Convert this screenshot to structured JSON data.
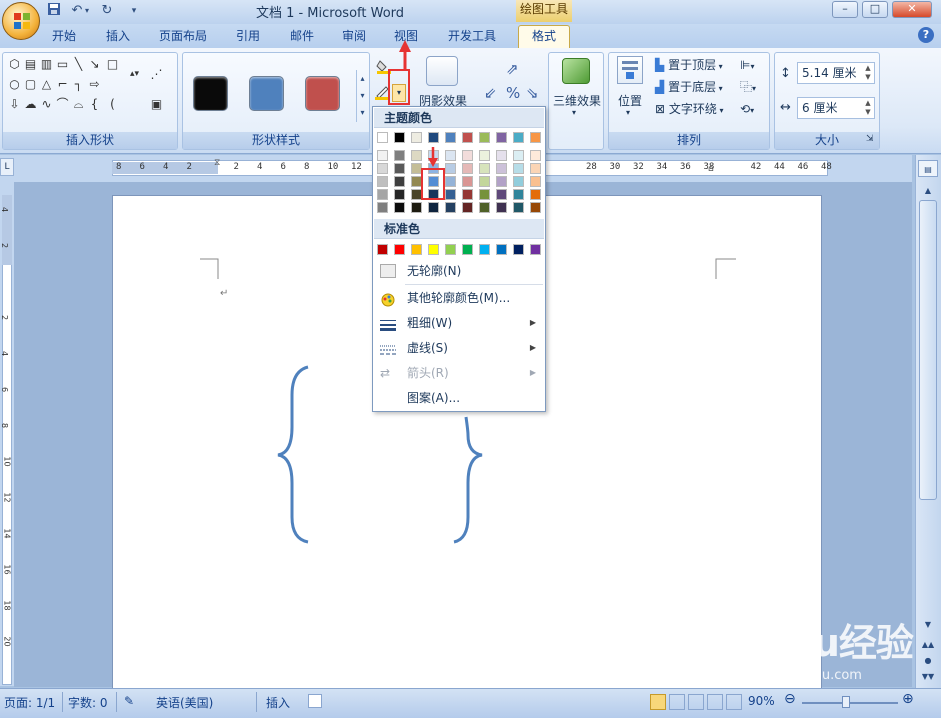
{
  "app": {
    "title": "文档 1 - Microsoft Word",
    "context_tab": "绘图工具",
    "window_buttons": [
      "–",
      "□",
      "✕"
    ]
  },
  "quick_access": {
    "items": [
      "save-icon",
      "undo-icon",
      "redo-icon",
      "customize-icon"
    ]
  },
  "tabs": [
    {
      "label": "开始"
    },
    {
      "label": "插入"
    },
    {
      "label": "页面布局"
    },
    {
      "label": "引用"
    },
    {
      "label": "邮件"
    },
    {
      "label": "审阅"
    },
    {
      "label": "视图"
    },
    {
      "label": "开发工具"
    },
    {
      "label": "格式"
    }
  ],
  "ribbon": {
    "insert_shapes_label": "插入形状",
    "shape_styles_label": "形状样式",
    "shadow_effect_label": "阴影效果",
    "three_d_label": "三维效果",
    "arrange_label": "排列",
    "size_label": "大小",
    "position_label": "位置",
    "bring_front": "置于顶层",
    "send_back": "置于底层",
    "text_wrap": "文字环绕",
    "height_value": "5.14 厘米",
    "width_value": "6 厘米",
    "style_colors": [
      "#0a0a0a",
      "#4f81bd",
      "#c0504d"
    ]
  },
  "ruler": {
    "ticks": [
      "8",
      "6",
      "4",
      "2",
      "",
      "2",
      "4",
      "6",
      "8",
      "10",
      "12",
      "",
      "",
      "",
      "",
      "",
      "",
      "",
      "",
      "",
      "28",
      "30",
      "32",
      "34",
      "36",
      "38",
      "",
      "42",
      "44",
      "46",
      "48"
    ]
  },
  "menu": {
    "theme_colors_label": "主题颜色",
    "standard_colors_label": "标准色",
    "theme_top": [
      "#ffffff",
      "#000000",
      "#eeece1",
      "#1f497d",
      "#4f81bd",
      "#c0504d",
      "#9bbb59",
      "#8064a2",
      "#4bacc6",
      "#f79646"
    ],
    "theme_grid": [
      [
        "#f2f2f2",
        "#7f7f7f",
        "#ddd9c3",
        "#c6d9f0",
        "#dbe5f1",
        "#f2dcdb",
        "#ebf1dd",
        "#e5e0ec",
        "#dbeef3",
        "#fdeada"
      ],
      [
        "#d8d8d8",
        "#595959",
        "#c4bd97",
        "#8db3e2",
        "#b8cce4",
        "#e5b9b7",
        "#d7e3bc",
        "#ccc1d9",
        "#b7dde8",
        "#fbd5b5"
      ],
      [
        "#bfbfbf",
        "#3f3f3f",
        "#938953",
        "#548dd4",
        "#95b3d7",
        "#d99694",
        "#c3d69b",
        "#b2a2c7",
        "#92cddc",
        "#fac08f"
      ],
      [
        "#a5a5a5",
        "#262626",
        "#494429",
        "#17365d",
        "#366092",
        "#953734",
        "#76923c",
        "#5f497a",
        "#31859b",
        "#e36c09"
      ],
      [
        "#7f7f7f",
        "#0c0c0c",
        "#1d1b10",
        "#0f243e",
        "#244061",
        "#632423",
        "#4f6128",
        "#3f3151",
        "#205867",
        "#974806"
      ]
    ],
    "standard": [
      "#c00000",
      "#ff0000",
      "#ffc000",
      "#ffff00",
      "#92d050",
      "#00b050",
      "#00b0f0",
      "#0070c0",
      "#002060",
      "#7030a0"
    ],
    "items": [
      {
        "label": "无轮廓(N)",
        "icon": "no-outline-icon"
      },
      {
        "label": "其他轮廓颜色(M)...",
        "icon": "more-colors-icon"
      },
      {
        "label": "粗细(W)",
        "icon": "weight-icon",
        "submenu": true
      },
      {
        "label": "虚线(S)",
        "icon": "dashes-icon",
        "submenu": true
      },
      {
        "label": "箭头(R)",
        "icon": "arrows-icon",
        "submenu": true,
        "disabled": true
      },
      {
        "label": "图案(A)...",
        "icon": "pattern-icon"
      }
    ]
  },
  "status": {
    "page": "页面: 1/1",
    "words": "字数: 0",
    "language": "英语(美国)",
    "mode": "插入",
    "zoom": "90%"
  },
  "watermark": {
    "brand": "Baidu经验",
    "sub": "jingyan.baidu.com"
  }
}
